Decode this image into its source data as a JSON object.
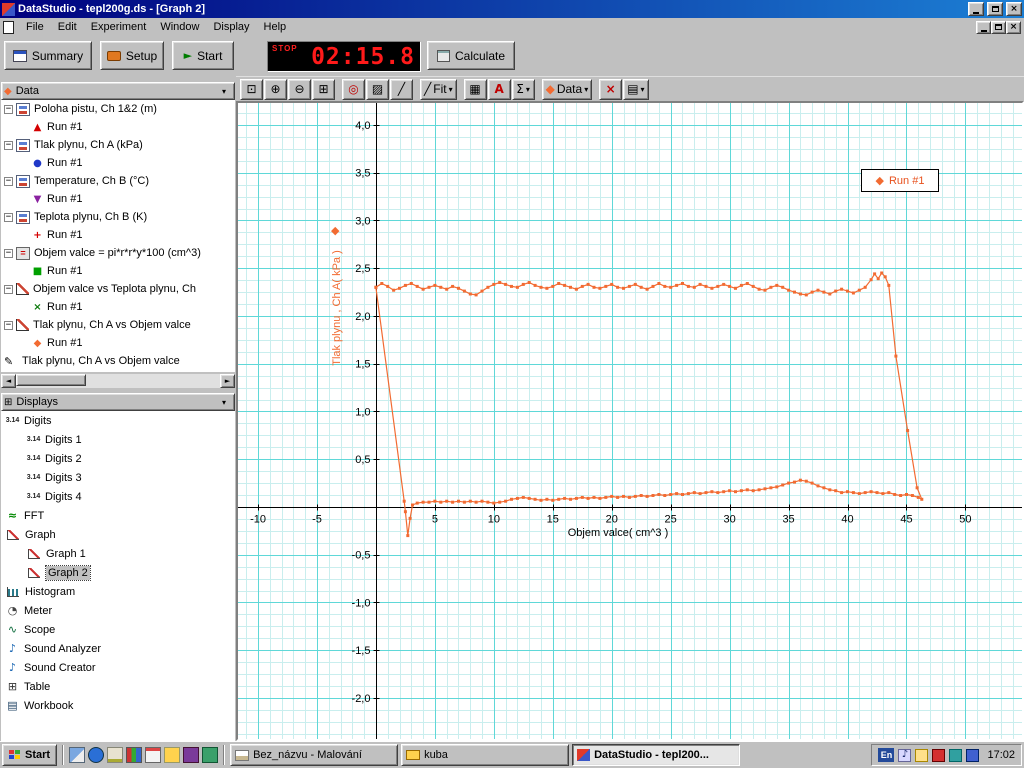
{
  "window": {
    "title": "DataStudio - tepl200g.ds - [Graph 2]"
  },
  "menu": {
    "items": [
      "File",
      "Edit",
      "Experiment",
      "Window",
      "Display",
      "Help"
    ]
  },
  "toolbar": {
    "summary": "Summary",
    "setup": "Setup",
    "start": "Start",
    "timer_label": "STOP",
    "timer_value": "02:15.8",
    "calculate": "Calculate"
  },
  "graph_toolbar": {
    "fit": "Fit",
    "data": "Data"
  },
  "icons": {
    "scale_to_fit": "⊡",
    "zoom_in": "⊕",
    "zoom_out": "⊖",
    "zoom_select": "⊞",
    "smart_tool": "◎",
    "highlight_tool": "▨",
    "slope_tool": "╱",
    "calculator": "▦",
    "text_tool": "A",
    "statistics": "Σ",
    "diamond": "◆",
    "delete": "×",
    "settings": "▤",
    "dropdown": "▾",
    "play": "►",
    "equals": "=",
    "pencil": "✎",
    "marker_triangle_up": "▲",
    "marker_circle": "●",
    "marker_triangle_down": "▼",
    "marker_plus": "+",
    "marker_square": "■",
    "marker_x": "×",
    "marker_diamond": "◆",
    "digits": "3.14",
    "fft": "≈",
    "note": "♪",
    "meter": "◔",
    "scope": "∿",
    "table_grid": "⊞",
    "workbook": "▤",
    "collapse": "−",
    "scroll_left": "◄",
    "scroll_right": "►",
    "close": "×"
  },
  "data_panel": {
    "header": "Data",
    "items": [
      {
        "label": "Poloha pistu, Ch 1&2 (m)"
      },
      {
        "label": "Run #1"
      },
      {
        "label": "Tlak plynu, Ch A (kPa)"
      },
      {
        "label": "Run #1"
      },
      {
        "label": "Temperature, Ch B (°C)"
      },
      {
        "label": "Run #1"
      },
      {
        "label": "Teplota plynu, Ch B (K)"
      },
      {
        "label": "Run #1"
      },
      {
        "label": "Objem valce = pi*r*r*y*100 (cm^3)"
      },
      {
        "label": "Run #1"
      },
      {
        "label": "Objem valce vs Teplota plynu, Ch"
      },
      {
        "label": "Run #1"
      },
      {
        "label": "Tlak plynu, Ch A vs Objem valce"
      },
      {
        "label": "Run #1"
      },
      {
        "label": "Tlak plynu, Ch A vs Objem valce"
      }
    ]
  },
  "displays_panel": {
    "header": "Displays",
    "items": [
      "Digits",
      "Digits 1",
      "Digits 2",
      "Digits 3",
      "Digits 4",
      "FFT",
      "Graph",
      "Graph 1",
      "Graph 2",
      "Histogram",
      "Meter",
      "Scope",
      "Sound Analyzer",
      "Sound Creator",
      "Table",
      "Workbook"
    ]
  },
  "taskbar": {
    "start": "Start",
    "tasks": [
      "Bez_názvu - Malování",
      "kuba",
      "DataStudio - tepl200..."
    ],
    "language": "En",
    "clock": "17:02"
  },
  "chart_data": {
    "type": "scatter",
    "title": "",
    "xlabel": "Objem valce( cm^3 )",
    "ylabel": "Tlak plynu , Ch A( kPa )",
    "xlim": [
      -11.7,
      54.8
    ],
    "ylim": [
      -2.43,
      4.23
    ],
    "x_ticks": {
      "values": [
        -10,
        -5,
        5,
        10,
        15,
        20,
        25,
        30,
        35,
        40,
        45,
        50
      ],
      "labels": [
        "-10",
        "-5",
        "5",
        "10",
        "15",
        "20",
        "25",
        "30",
        "35",
        "40",
        "45",
        "50"
      ]
    },
    "y_ticks": {
      "values": [
        4,
        3.5,
        3,
        2.5,
        2,
        1.5,
        1,
        0.5,
        -0.5,
        -1,
        -1.5,
        -2
      ],
      "labels": [
        "4,0",
        "3,5",
        "3,0",
        "2,5",
        "2,0",
        "1,5",
        "1,0",
        "0,5",
        "-0,5",
        "-1,0",
        "-1,5",
        "-2,0"
      ]
    },
    "grid": {
      "minor_x": 1,
      "major_x": 5,
      "minor_y": 0.125,
      "major_y": 0.5,
      "minor_color": "#c9eeee",
      "major_color": "#5fd8d8"
    },
    "axis_color": "#000000",
    "legend_position": "top-right",
    "series": [
      {
        "name": "Run #1",
        "color": "#f26b32",
        "points": [
          [
            0,
            2.3
          ],
          [
            0.5,
            2.34
          ],
          [
            1,
            2.31
          ],
          [
            1.5,
            2.27
          ],
          [
            2,
            2.29
          ],
          [
            2.5,
            2.32
          ],
          [
            3,
            2.34
          ],
          [
            3.5,
            2.31
          ],
          [
            4,
            2.28
          ],
          [
            4.5,
            2.3
          ],
          [
            5,
            2.32
          ],
          [
            5.5,
            2.3
          ],
          [
            6,
            2.28
          ],
          [
            6.5,
            2.31
          ],
          [
            7,
            2.29
          ],
          [
            7.5,
            2.26
          ],
          [
            8,
            2.23
          ],
          [
            8.5,
            2.22
          ],
          [
            9,
            2.26
          ],
          [
            9.5,
            2.3
          ],
          [
            10,
            2.33
          ],
          [
            10.5,
            2.35
          ],
          [
            11,
            2.33
          ],
          [
            11.5,
            2.31
          ],
          [
            12,
            2.3
          ],
          [
            12.5,
            2.33
          ],
          [
            13,
            2.35
          ],
          [
            13.5,
            2.32
          ],
          [
            14,
            2.3
          ],
          [
            14.5,
            2.29
          ],
          [
            15,
            2.31
          ],
          [
            15.5,
            2.34
          ],
          [
            16,
            2.32
          ],
          [
            16.5,
            2.3
          ],
          [
            17,
            2.28
          ],
          [
            17.5,
            2.31
          ],
          [
            18,
            2.33
          ],
          [
            18.5,
            2.3
          ],
          [
            19,
            2.29
          ],
          [
            19.5,
            2.31
          ],
          [
            20,
            2.33
          ],
          [
            20.5,
            2.3
          ],
          [
            21,
            2.29
          ],
          [
            21.5,
            2.31
          ],
          [
            22,
            2.33
          ],
          [
            22.5,
            2.3
          ],
          [
            23,
            2.28
          ],
          [
            23.5,
            2.31
          ],
          [
            24,
            2.34
          ],
          [
            24.5,
            2.31
          ],
          [
            25,
            2.3
          ],
          [
            25.5,
            2.32
          ],
          [
            26,
            2.34
          ],
          [
            26.5,
            2.31
          ],
          [
            27,
            2.3
          ],
          [
            27.5,
            2.33
          ],
          [
            28,
            2.31
          ],
          [
            28.5,
            2.29
          ],
          [
            29,
            2.31
          ],
          [
            29.5,
            2.33
          ],
          [
            30,
            2.31
          ],
          [
            30.5,
            2.29
          ],
          [
            31,
            2.32
          ],
          [
            31.5,
            2.34
          ],
          [
            32,
            2.31
          ],
          [
            32.5,
            2.28
          ],
          [
            33,
            2.27
          ],
          [
            33.5,
            2.3
          ],
          [
            34,
            2.32
          ],
          [
            34.5,
            2.3
          ],
          [
            35,
            2.27
          ],
          [
            35.5,
            2.25
          ],
          [
            36,
            2.23
          ],
          [
            36.5,
            2.22
          ],
          [
            37,
            2.25
          ],
          [
            37.5,
            2.27
          ],
          [
            38,
            2.25
          ],
          [
            38.5,
            2.23
          ],
          [
            39,
            2.26
          ],
          [
            39.5,
            2.28
          ],
          [
            40,
            2.26
          ],
          [
            40.5,
            2.24
          ],
          [
            41,
            2.27
          ],
          [
            41.5,
            2.3
          ],
          [
            42,
            2.38
          ],
          [
            42.3,
            2.44
          ],
          [
            42.6,
            2.39
          ],
          [
            42.9,
            2.45
          ],
          [
            43.2,
            2.41
          ],
          [
            43.5,
            2.32
          ],
          [
            44.1,
            1.58
          ],
          [
            45.1,
            0.8
          ],
          [
            45.9,
            0.2
          ],
          [
            46.3,
            0.08
          ],
          [
            46,
            0.1
          ],
          [
            45.5,
            0.12
          ],
          [
            45,
            0.13
          ],
          [
            44.5,
            0.12
          ],
          [
            44,
            0.13
          ],
          [
            43.5,
            0.15
          ],
          [
            43,
            0.14
          ],
          [
            42.5,
            0.15
          ],
          [
            42,
            0.16
          ],
          [
            41.5,
            0.15
          ],
          [
            41,
            0.14
          ],
          [
            40.5,
            0.15
          ],
          [
            40,
            0.16
          ],
          [
            39.5,
            0.15
          ],
          [
            39,
            0.17
          ],
          [
            38.5,
            0.18
          ],
          [
            38,
            0.2
          ],
          [
            37.5,
            0.22
          ],
          [
            37,
            0.25
          ],
          [
            36.5,
            0.27
          ],
          [
            36,
            0.28
          ],
          [
            35.5,
            0.26
          ],
          [
            35,
            0.25
          ],
          [
            34.5,
            0.23
          ],
          [
            34,
            0.21
          ],
          [
            33.5,
            0.2
          ],
          [
            33,
            0.19
          ],
          [
            32.5,
            0.18
          ],
          [
            32,
            0.17
          ],
          [
            31.5,
            0.18
          ],
          [
            31,
            0.17
          ],
          [
            30.5,
            0.16
          ],
          [
            30,
            0.17
          ],
          [
            29.5,
            0.16
          ],
          [
            29,
            0.15
          ],
          [
            28.5,
            0.16
          ],
          [
            28,
            0.15
          ],
          [
            27.5,
            0.14
          ],
          [
            27,
            0.15
          ],
          [
            26.5,
            0.14
          ],
          [
            26,
            0.13
          ],
          [
            25.5,
            0.14
          ],
          [
            25,
            0.13
          ],
          [
            24.5,
            0.12
          ],
          [
            24,
            0.13
          ],
          [
            23.5,
            0.12
          ],
          [
            23,
            0.11
          ],
          [
            22.5,
            0.12
          ],
          [
            22,
            0.11
          ],
          [
            21.5,
            0.1
          ],
          [
            21,
            0.11
          ],
          [
            20.5,
            0.1
          ],
          [
            20,
            0.11
          ],
          [
            19.5,
            0.1
          ],
          [
            19,
            0.09
          ],
          [
            18.5,
            0.1
          ],
          [
            18,
            0.09
          ],
          [
            17.5,
            0.1
          ],
          [
            17,
            0.09
          ],
          [
            16.5,
            0.08
          ],
          [
            16,
            0.09
          ],
          [
            15.5,
            0.08
          ],
          [
            15,
            0.07
          ],
          [
            14.5,
            0.08
          ],
          [
            14,
            0.07
          ],
          [
            13.5,
            0.08
          ],
          [
            13,
            0.09
          ],
          [
            12.5,
            0.1
          ],
          [
            12,
            0.09
          ],
          [
            11.5,
            0.08
          ],
          [
            11,
            0.06
          ],
          [
            10.5,
            0.05
          ],
          [
            10,
            0.04
          ],
          [
            9.5,
            0.05
          ],
          [
            9,
            0.06
          ],
          [
            8.5,
            0.05
          ],
          [
            8,
            0.06
          ],
          [
            7.5,
            0.05
          ],
          [
            7,
            0.06
          ],
          [
            6.5,
            0.05
          ],
          [
            6,
            0.06
          ],
          [
            5.5,
            0.05
          ],
          [
            5,
            0.06
          ],
          [
            4.5,
            0.05
          ],
          [
            4,
            0.05
          ],
          [
            3.5,
            0.04
          ],
          [
            3.1,
            0.02
          ],
          [
            2.9,
            -0.12
          ],
          [
            2.7,
            -0.3
          ],
          [
            2.5,
            -0.05
          ],
          [
            2.4,
            0.06
          ],
          [
            0,
            2.3
          ]
        ]
      }
    ]
  }
}
